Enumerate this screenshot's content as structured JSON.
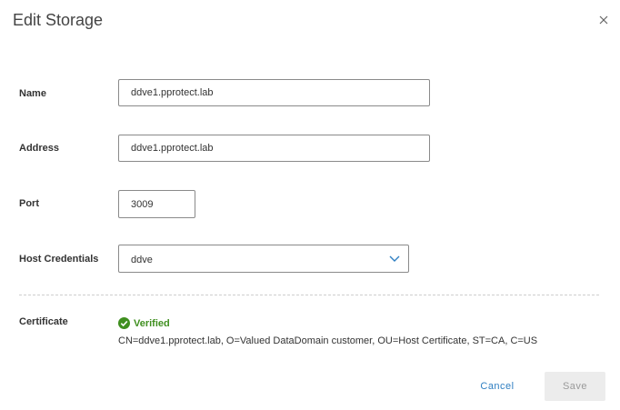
{
  "dialog": {
    "title": "Edit Storage",
    "close_icon": "close-icon"
  },
  "form": {
    "name": {
      "label": "Name",
      "value": "ddve1.pprotect.lab"
    },
    "address": {
      "label": "Address",
      "value": "ddve1.pprotect.lab"
    },
    "port": {
      "label": "Port",
      "value": "3009"
    },
    "host_credentials": {
      "label": "Host Credentials",
      "selected": "ddve",
      "icon": "chevron-down-icon"
    },
    "certificate": {
      "label": "Certificate",
      "status": "Verified",
      "status_icon": "check-circle-icon",
      "status_color": "#3f8f1f",
      "detail": "CN=ddve1.pprotect.lab, O=Valued DataDomain customer, OU=Host Certificate, ST=CA, C=US"
    }
  },
  "footer": {
    "cancel_label": "Cancel",
    "save_label": "Save"
  },
  "colors": {
    "accent": "#2f7fc2",
    "verified": "#3f8f1f",
    "disabled_bg": "#ececec",
    "disabled_text": "#9a9a9a"
  }
}
